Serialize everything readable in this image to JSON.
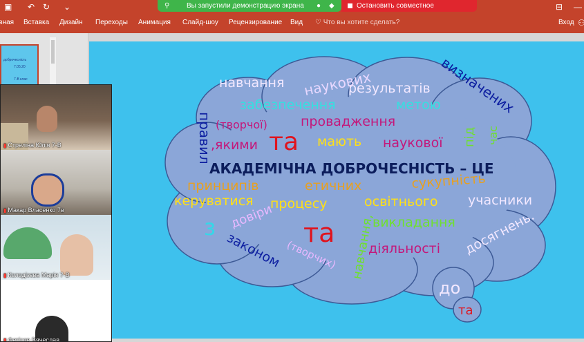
{
  "share": {
    "running_text": "Вы запустили демонстрацию экрана",
    "stop_text": "Остановить совместное использование"
  },
  "ribbon": {
    "tabs": [
      "Главная",
      "Вставка",
      "Дизайн",
      "Переходы",
      "Анимация",
      "Слайд-шоу",
      "Рецензирование",
      "Вид"
    ],
    "tell_me": "Что вы хотите сделать?",
    "signin": "Вход"
  },
  "thumbnail": {
    "line1": "доброчесність",
    "line2": "7.05.20",
    "line3": "7-В клас"
  },
  "slide": {
    "heading": "АКАДЕМІЧНА ДОБРОЧЕСНІСТЬ – ЦЕ",
    "words": {
      "navchannya": "навчання",
      "naukovykh": "наукових",
      "rezultativ": "результатів",
      "vyznachenykh": "визначених",
      "zabezpechennya": "забезпечення",
      "metoyu": "метою",
      "pravyl": "правил",
      "tvorchoyi": "(творчої)",
      "ta1": "та",
      "provadzhennya": "провадження",
      "pid": "під",
      "chas": "час",
      "yakymy": ",якими",
      "mayut": "мають",
      "naukovoyi": "наукової",
      "pryntsypiv": "принципів",
      "etychnykh": "етичних",
      "sukupnist": "сукупність",
      "uchasnyky": "учасники",
      "keruvatysya": "керуватися",
      "protsesu": "процесу",
      "osvitnoho": "освітнього",
      "z": "з",
      "dovir": "довіри",
      "ta2": "та",
      "navchannya2": "навчання,",
      "vykladannya": "викладання",
      "dosyahnen": "досягнень.",
      "zakonom": "законом",
      "tvorchykh": "(творчих)",
      "diyalnosti": "діяльності",
      "do": "до",
      "ta3": "та"
    }
  },
  "participants": [
    {
      "name": "Стреліна Юлія  7-В"
    },
    {
      "name": "Макар Власенко 7в"
    },
    {
      "name": "Колодізєва Марія 7-В"
    },
    {
      "name": "Фетісов Вячеслав"
    }
  ],
  "colors": {
    "ribbon": "#c4432b",
    "share_green": "#3fb54a",
    "stop_red": "#e0262e",
    "slide_bg": "#3ec1ed",
    "cloud_fill": "#8ba6d8"
  }
}
